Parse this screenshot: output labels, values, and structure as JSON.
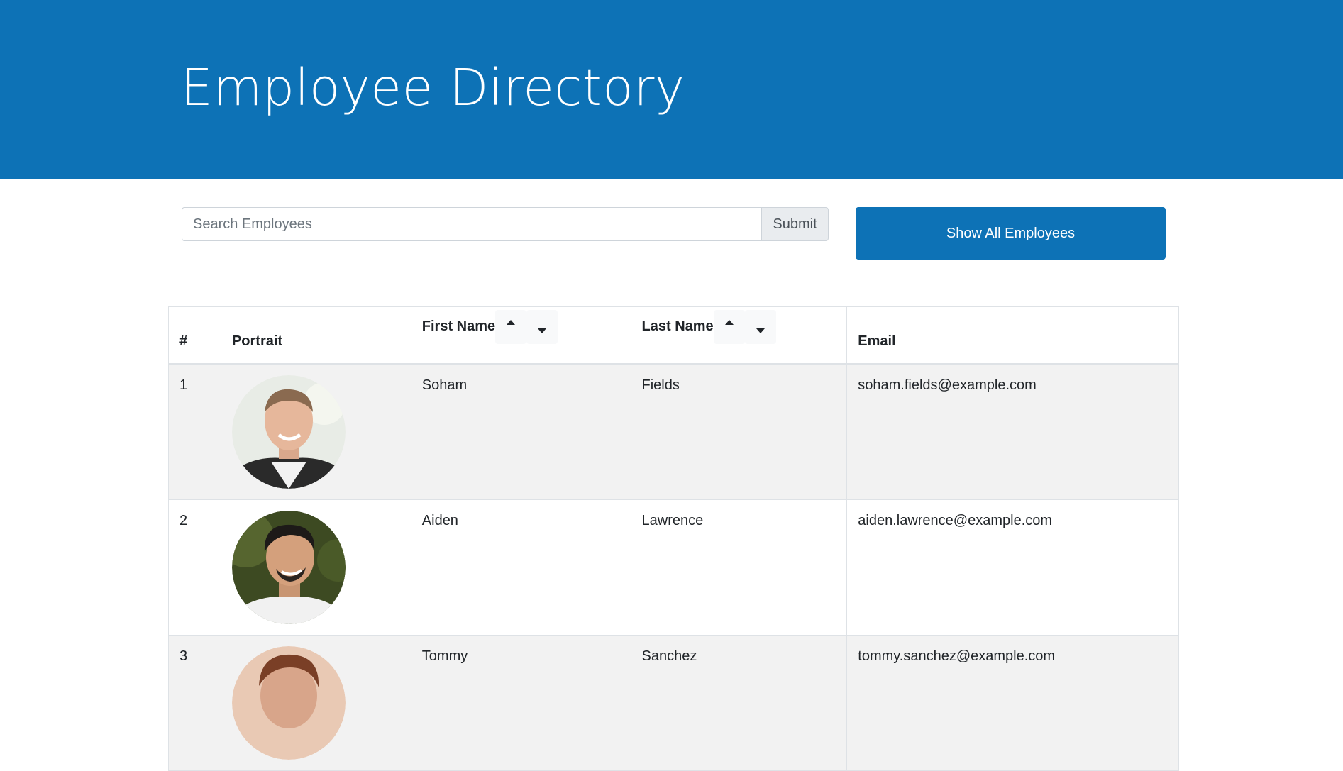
{
  "header": {
    "title": "Employee Directory"
  },
  "search": {
    "placeholder": "Search Employees",
    "value": "",
    "submit_label": "Submit"
  },
  "show_all_label": "Show All Employees",
  "table": {
    "columns": {
      "index": "#",
      "portrait": "Portrait",
      "first_name": "First Name",
      "last_name": "Last Name",
      "email": "Email"
    },
    "rows": [
      {
        "index": "1",
        "first_name": "Soham",
        "last_name": "Fields",
        "email": "soham.fields@example.com"
      },
      {
        "index": "2",
        "first_name": "Aiden",
        "last_name": "Lawrence",
        "email": "aiden.lawrence@example.com"
      },
      {
        "index": "3",
        "first_name": "Tommy",
        "last_name": "Sanchez",
        "email": "tommy.sanchez@example.com"
      }
    ]
  },
  "colors": {
    "brand": "#0d72b6",
    "row_stripe": "#f2f2f2"
  }
}
